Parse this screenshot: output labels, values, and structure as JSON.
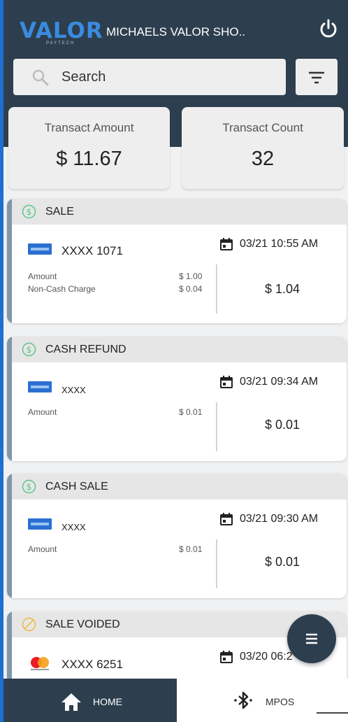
{
  "header": {
    "logo_text": "VALOR",
    "logo_sub": "PAYTECH",
    "merchant_name": "MICHAELS VALOR SHO..",
    "power_icon": "power-icon"
  },
  "search": {
    "placeholder": "Search",
    "filter_icon": "filter-icon"
  },
  "stats": {
    "amount_label": "Transact Amount",
    "amount_value": "$ 11.67",
    "count_label": "Transact Count",
    "count_value": "32"
  },
  "transactions": [
    {
      "type": "SALE",
      "status_icon": "dollar-circle-icon",
      "card_icon": "amex-card-icon",
      "card_number": "XXXX 1071",
      "datetime": "03/21 10:55 AM",
      "rows": [
        {
          "label": "Amount",
          "value": "$ 1.00"
        },
        {
          "label": "Non-Cash Charge",
          "value": "$ 0.04"
        }
      ],
      "total": "$ 1.04"
    },
    {
      "type": "CASH REFUND",
      "status_icon": "dollar-circle-icon",
      "card_icon": "amex-card-icon",
      "card_number": "XXXX",
      "datetime": "03/21 09:34 AM",
      "rows": [
        {
          "label": "Amount",
          "value": "$ 0.01"
        }
      ],
      "total": "$ 0.01"
    },
    {
      "type": "CASH SALE",
      "status_icon": "dollar-circle-icon",
      "card_icon": "amex-card-icon",
      "card_number": "XXXX",
      "datetime": "03/21 09:30 AM",
      "rows": [
        {
          "label": "Amount",
          "value": "$ 0.01"
        }
      ],
      "total": "$ 0.01"
    },
    {
      "type": "SALE VOIDED",
      "status_icon": "void-icon",
      "card_icon": "mastercard-icon",
      "card_number": "XXXX 6251",
      "datetime": "03/20 06:2"
    }
  ],
  "fab": {
    "icon": "menu-icon"
  },
  "bottom_nav": {
    "home_label": "HOME",
    "home_icon": "home-icon",
    "mpos_label": "MPOS",
    "mpos_icon": "bluetooth-icon"
  },
  "colors": {
    "header_bg": "#2d3f4e",
    "accent_blue": "#3a8be0",
    "card_stripe": "#7e97aa",
    "status_green": "#5cc48a",
    "void_yellow": "#f0b93a"
  }
}
